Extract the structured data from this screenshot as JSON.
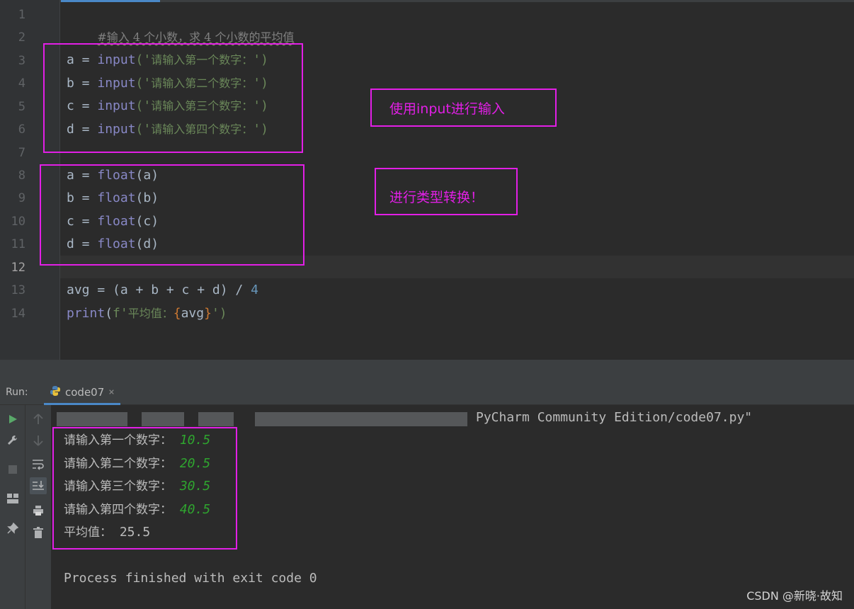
{
  "editor": {
    "line_numbers": [
      "1",
      "2",
      "3",
      "4",
      "5",
      "6",
      "7",
      "8",
      "9",
      "10",
      "11",
      "12",
      "13",
      "14"
    ],
    "current_line": "12",
    "comment": "#输入 4 个小数，求 4 个小数的平均值",
    "input_lines": [
      {
        "var": "a",
        "op": " = ",
        "fn": "input",
        "open": "('",
        "prompt": "请输入第一个数字：",
        "close": "')"
      },
      {
        "var": "b",
        "op": " = ",
        "fn": "input",
        "open": "('",
        "prompt": "请输入第二个数字：",
        "close": "')"
      },
      {
        "var": "c",
        "op": " = ",
        "fn": "input",
        "open": "('",
        "prompt": "请输入第三个数字：",
        "close": "')"
      },
      {
        "var": "d",
        "op": " = ",
        "fn": "input",
        "open": "('",
        "prompt": "请输入第四个数字：",
        "close": "')"
      }
    ],
    "float_lines": [
      {
        "var": "a",
        "op": " = ",
        "fn": "float",
        "arg": "(a)"
      },
      {
        "var": "b",
        "op": " = ",
        "fn": "float",
        "arg": "(b)"
      },
      {
        "var": "c",
        "op": " = ",
        "fn": "float",
        "arg": "(c)"
      },
      {
        "var": "d",
        "op": " = ",
        "fn": "float",
        "arg": "(d)"
      }
    ],
    "avg_line": {
      "expr": "avg = (a + b + c + d) / ",
      "num": "4"
    },
    "print_line": {
      "fn": "print",
      "open": "(",
      "fprefix": "f'",
      "label": "平均值：",
      "lbrace": "{",
      "var": "avg",
      "rbrace": "}",
      "close": "')"
    }
  },
  "annotations": {
    "input_note": "使用input进行输入",
    "convert_note": "进行类型转换！"
  },
  "run_panel": {
    "label": "Run:",
    "tab_name": "code07",
    "tab_close": "×",
    "path_tail": "PyCharm Community Edition/code07.py\"",
    "outputs": [
      {
        "prompt": "请输入第一个数字：",
        "value": "10.5"
      },
      {
        "prompt": "请输入第二个数字：",
        "value": "20.5"
      },
      {
        "prompt": "请输入第三个数字：",
        "value": "30.5"
      },
      {
        "prompt": "请输入第四个数字：",
        "value": "40.5"
      }
    ],
    "result_label": "平均值：",
    "result_value": " 25.5",
    "exit_message": "Process finished with exit code 0"
  },
  "watermark": "CSDN @新晓·故知",
  "colors": {
    "annotation": "#e21fe6",
    "input_value": "#2fa52f",
    "keyword": "#8888c6",
    "string": "#6a8759"
  }
}
